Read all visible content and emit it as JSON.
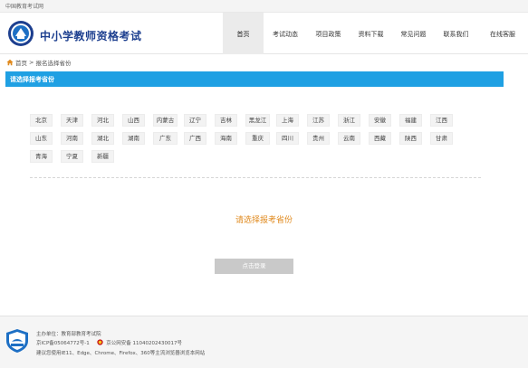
{
  "topbar": {
    "text": "中国教育考试网"
  },
  "header": {
    "site_title": "中小学教师资格考试",
    "logo_icon": "ntce-logo-icon"
  },
  "nav": {
    "items": [
      {
        "label": "首页",
        "active": true
      },
      {
        "label": "考试动态",
        "active": false
      },
      {
        "label": "项目政策",
        "active": false
      },
      {
        "label": "资料下载",
        "active": false
      },
      {
        "label": "常见问题",
        "active": false
      },
      {
        "label": "联系我们",
        "active": false
      },
      {
        "label": "在线客服",
        "active": false
      }
    ]
  },
  "breadcrumb": {
    "home": "首页",
    "separator": ">",
    "current": "报名选择省份"
  },
  "section": {
    "title": "请选择报考省份"
  },
  "provinces": {
    "row1": [
      "北京",
      "天津",
      "河北",
      "山西",
      "内蒙古",
      "辽宁",
      "吉林",
      "黑龙江",
      "上海",
      "江苏",
      "浙江",
      "安徽",
      "福建",
      "江西"
    ],
    "row2": [
      "山东",
      "河南",
      "湖北",
      "湖南",
      "广东",
      "广西",
      "海南",
      "重庆",
      "四川",
      "贵州",
      "云南",
      "西藏",
      "陕西",
      "甘肃"
    ],
    "row3": [
      "青海",
      "宁夏",
      "新疆"
    ]
  },
  "prompt": "请选择报考省份",
  "login_button": "点击登录",
  "footer": {
    "sponsor": "主办单位：教育部教育考试院",
    "icp": "京ICP备05064772号-1",
    "police": "京公网安备 11040202430017号",
    "browser_tip": "建议您使用IE11、Edge、Chrome、Firefox、360等主流浏览器浏览本网站",
    "logo_icon": "ntce-footer-shield-icon",
    "police_icon": "police-badge-icon"
  },
  "colors": {
    "accent_blue": "#1fa0e3",
    "title_blue": "#1d3f8f",
    "prompt_orange": "#e08a1e"
  }
}
